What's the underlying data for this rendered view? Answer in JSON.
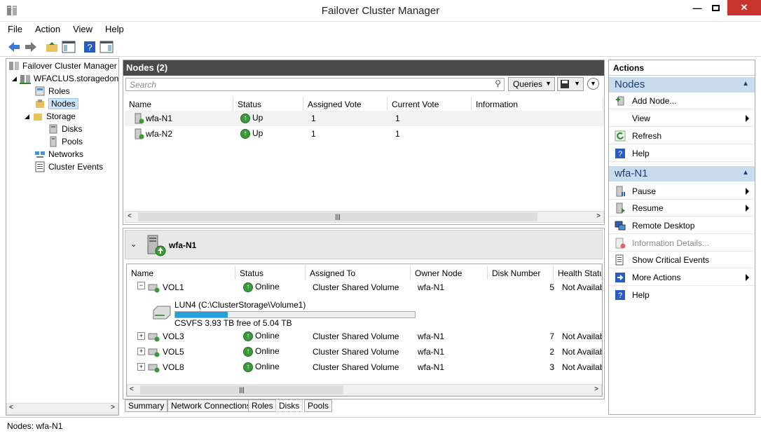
{
  "window": {
    "title": "Failover Cluster Manager"
  },
  "menu": [
    "File",
    "Action",
    "View",
    "Help"
  ],
  "tree": {
    "root": "Failover Cluster Manager",
    "cluster": "WFACLUS.storagedon",
    "items": [
      "Roles",
      "Nodes",
      "Storage",
      "Disks",
      "Pools",
      "Networks",
      "Cluster Events"
    ]
  },
  "nodes_pane": {
    "title": "Nodes (2)",
    "search_placeholder": "Search",
    "queries_label": "Queries",
    "columns": [
      "Name",
      "Status",
      "Assigned Vote",
      "Current Vote",
      "Information"
    ],
    "rows": [
      {
        "name": "wfa-N1",
        "status": "Up",
        "assigned": "1",
        "current": "1"
      },
      {
        "name": "wfa-N2",
        "status": "Up",
        "assigned": "1",
        "current": "1"
      }
    ]
  },
  "detail": {
    "node": "wfa-N1",
    "columns": [
      "Name",
      "Status",
      "Assigned To",
      "Owner Node",
      "Disk Number",
      "Health Statu"
    ],
    "rows": [
      {
        "name": "VOL1",
        "status": "Online",
        "assigned": "Cluster Shared Volume",
        "owner": "wfa-N1",
        "disk": "5",
        "health": "Not Availab"
      },
      {
        "name": "VOL3",
        "status": "Online",
        "assigned": "Cluster Shared Volume",
        "owner": "wfa-N1",
        "disk": "7",
        "health": "Not Availab"
      },
      {
        "name": "VOL5",
        "status": "Online",
        "assigned": "Cluster Shared Volume",
        "owner": "wfa-N1",
        "disk": "2",
        "health": "Not Availab"
      },
      {
        "name": "VOL8",
        "status": "Online",
        "assigned": "Cluster Shared Volume",
        "owner": "wfa-N1",
        "disk": "3",
        "health": "Not Availab"
      }
    ],
    "volume": {
      "label": "LUN4 (C:\\ClusterStorage\\Volume1)",
      "free": "CSVFS 3.93 TB free of 5.04 TB",
      "used_fraction": 0.22
    }
  },
  "tabs": [
    "Summary",
    "Network Connections",
    "Roles",
    "Disks",
    "Pools"
  ],
  "actions": {
    "header": "Actions",
    "section1": "Nodes",
    "section1_items": [
      "Add Node...",
      "View",
      "Refresh",
      "Help"
    ],
    "section2": "wfa-N1",
    "section2_items": [
      "Pause",
      "Resume",
      "Remote Desktop",
      "Information Details...",
      "Show Critical Events",
      "More Actions",
      "Help"
    ]
  },
  "statusbar": {
    "text": "Nodes:  wfa-N1"
  }
}
